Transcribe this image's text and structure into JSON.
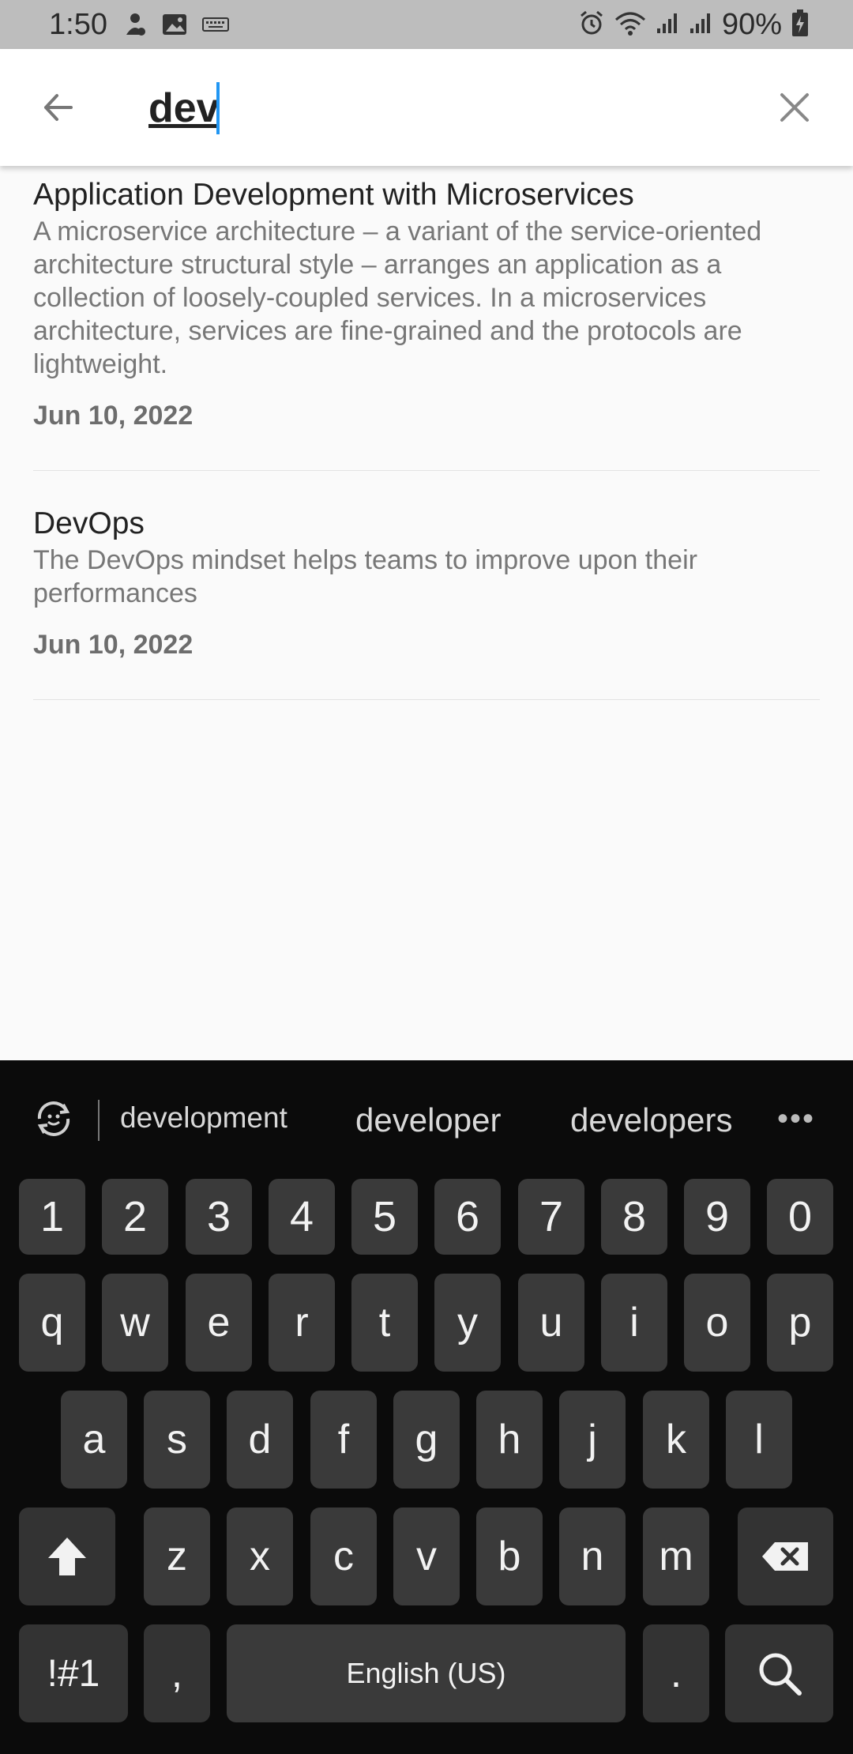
{
  "status_bar": {
    "time": "1:50",
    "battery": "90%",
    "left_icons": [
      "notification-icon",
      "image-icon",
      "keyboard-icon"
    ],
    "right_icons": [
      "alarm-icon",
      "wifi-icon",
      "signal-icon",
      "signal-icon",
      "battery-charging-icon"
    ]
  },
  "search": {
    "value": "dev",
    "back_icon": "arrow-left-icon",
    "clear_icon": "close-icon"
  },
  "results": [
    {
      "title": "Application Development with Microservices",
      "description": "A microservice architecture – a variant of the service-oriented architecture structural style – arranges an application as a collection of loosely-coupled services. In a microservices architecture, services are fine-grained and the protocols are lightweight.",
      "date": "Jun 10, 2022"
    },
    {
      "title": "DevOps",
      "description": "The DevOps mindset helps teams to improve upon their performances",
      "date": "Jun 10, 2022"
    }
  ],
  "keyboard": {
    "suggestions": [
      "development",
      "developer",
      "developers"
    ],
    "more": "•••",
    "row_numbers": [
      "1",
      "2",
      "3",
      "4",
      "5",
      "6",
      "7",
      "8",
      "9",
      "0"
    ],
    "row_1": [
      "q",
      "w",
      "e",
      "r",
      "t",
      "y",
      "u",
      "i",
      "o",
      "p"
    ],
    "row_2": [
      "a",
      "s",
      "d",
      "f",
      "g",
      "h",
      "j",
      "k",
      "l"
    ],
    "row_3": [
      "z",
      "x",
      "c",
      "v",
      "b",
      "n",
      "m"
    ],
    "symbols_label": "!#1",
    "comma_label": ",",
    "space_label": "English (US)",
    "period_label": ".",
    "colors": {
      "background": "#0b0b0b",
      "key": "#3a3a3a",
      "key_text": "#f2f2f2"
    }
  }
}
